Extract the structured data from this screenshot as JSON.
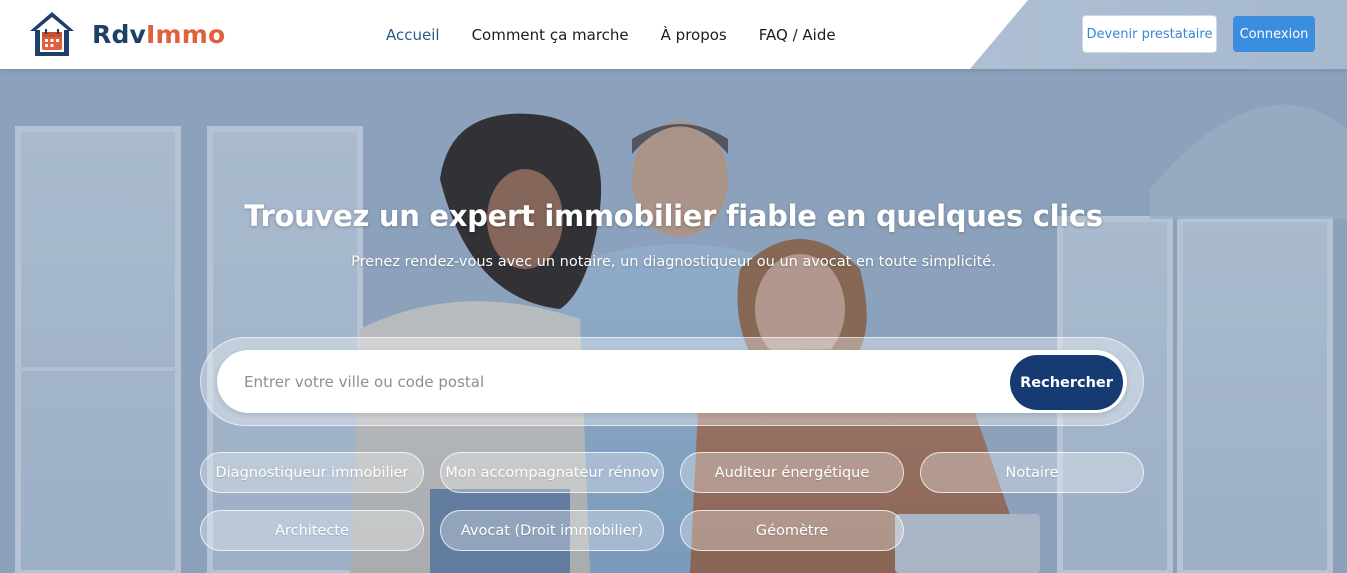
{
  "header": {
    "logo": {
      "part1": "Rdv",
      "part2": "Immo"
    },
    "nav": [
      {
        "label": "Accueil",
        "active": true
      },
      {
        "label": "Comment ça marche",
        "active": false
      },
      {
        "label": "À propos",
        "active": false
      },
      {
        "label": "FAQ / Aide",
        "active": false
      }
    ],
    "become_provider_label": "Devenir prestataire",
    "login_label": "Connexion"
  },
  "hero": {
    "title": "Trouvez un expert immobilier fiable en quelques clics",
    "subtitle": "Prenez rendez-vous avec un notaire, un diagnostiqueur ou un avocat en toute simplicité.",
    "search": {
      "placeholder": "Entrer votre ville ou code postal",
      "value": "",
      "button_label": "Rechercher"
    },
    "categories": [
      "Diagnostiqueur immobilier",
      "Mon accompagnateur rénnov",
      "Auditeur énergétique",
      "Notaire",
      "Architecte",
      "Avocat (Droit immobilier)",
      "Géomètre"
    ]
  },
  "colors": {
    "brand_navy": "#1f3f6b",
    "brand_orange": "#e0603e",
    "primary_button": "#3b8de0",
    "search_button": "#163b73",
    "nav_active": "#2a5a8a"
  },
  "icons": {
    "logo": "house-calendar-icon"
  }
}
